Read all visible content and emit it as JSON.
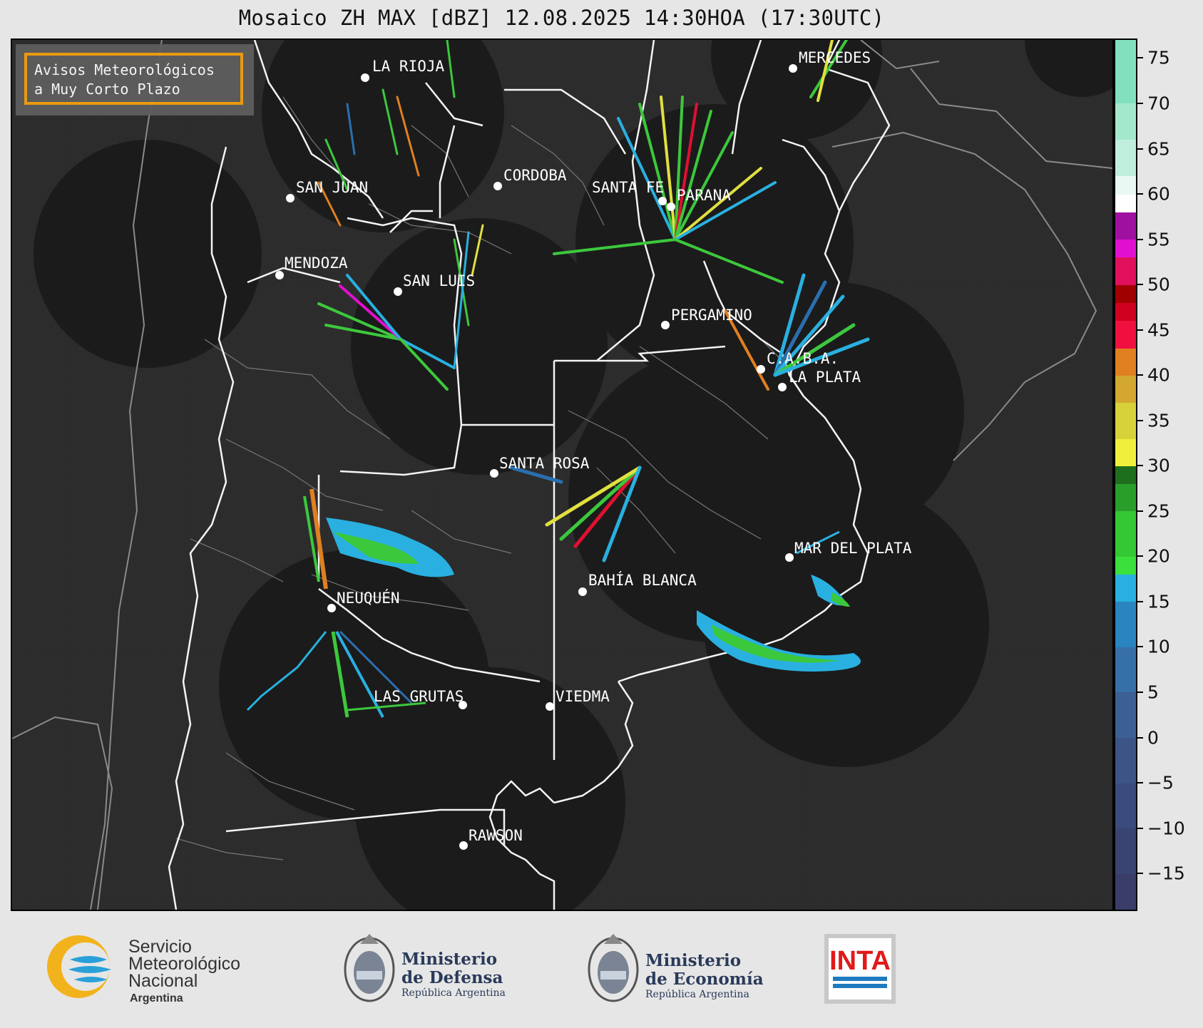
{
  "title": "Mosaico ZH MAX [dBZ] 12.08.2025 14:30HOA (17:30UTC)",
  "legend_box": {
    "line1": "Avisos Meteorológicos",
    "line2": "a Muy Corto Plazo"
  },
  "colorbar": {
    "unit": "dBZ",
    "min": -19,
    "max": 77,
    "tick_labels": [
      "75",
      "70",
      "65",
      "60",
      "55",
      "50",
      "45",
      "40",
      "35",
      "30",
      "25",
      "20",
      "15",
      "10",
      "5",
      "0",
      "−5",
      "−10",
      "−15"
    ],
    "tick_values": [
      75,
      70,
      65,
      60,
      55,
      50,
      45,
      40,
      35,
      30,
      25,
      20,
      15,
      10,
      5,
      0,
      -5,
      -10,
      -15
    ],
    "colors": {
      "low_dark": "#3c3f6b",
      "blue": "#2a6fb0",
      "light_blue": "#29b0e0",
      "green": "#3cc83c",
      "dark_green": "#1e6e1e",
      "yellow": "#f0f03c",
      "orange": "#e08020",
      "red": "#e01030",
      "dark_red": "#a00000",
      "magenta": "#e010d0",
      "purple": "#8a0a8a",
      "white": "#ffffff",
      "mint": "#80e0c0"
    }
  },
  "map": {
    "background": "#2c2c2c",
    "radar_disc": "#1b1b1b",
    "cities": [
      {
        "name": "LA RIOJA"
      },
      {
        "name": "SAN JUAN"
      },
      {
        "name": "CORDOBA"
      },
      {
        "name": "SANTA FE"
      },
      {
        "name": "PARANA"
      },
      {
        "name": "MERCEDES"
      },
      {
        "name": "MENDOZA"
      },
      {
        "name": "SAN LUIS"
      },
      {
        "name": "PERGAMINO"
      },
      {
        "name": "C.A.B.A."
      },
      {
        "name": "LA PLATA"
      },
      {
        "name": "SANTA ROSA"
      },
      {
        "name": "MAR DEL PLATA"
      },
      {
        "name": "NEUQUÉN"
      },
      {
        "name": "BAHÍA BLANCA"
      },
      {
        "name": "LAS GRUTAS"
      },
      {
        "name": "VIEDMA"
      },
      {
        "name": "RAWSON"
      }
    ]
  },
  "logos": {
    "smn": {
      "line1": "Servicio",
      "line2": "Meteorológico",
      "line3": "Nacional",
      "line4": "Argentina"
    },
    "defensa": {
      "line1": "Ministerio",
      "line2": "de Defensa",
      "line3": "República Argentina"
    },
    "economia": {
      "line1": "Ministerio",
      "line2": "de Economía",
      "line3": "República Argentina"
    },
    "inta": {
      "text": "INTA"
    }
  }
}
